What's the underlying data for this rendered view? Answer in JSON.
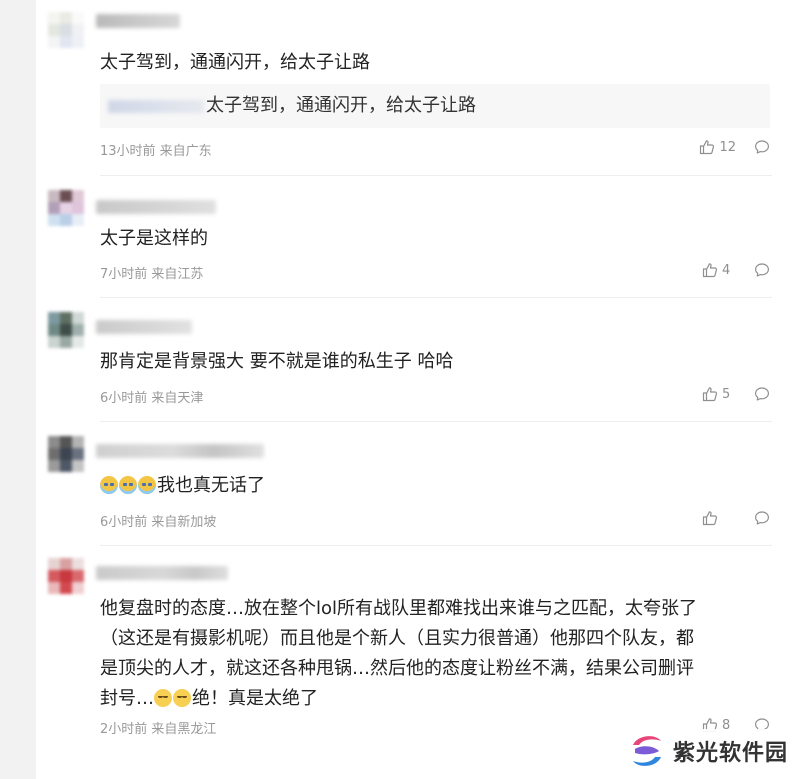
{
  "comments": [
    {
      "text": "太子驾到，通通闪开，给太子让路",
      "quote_text": "太子驾到，通通闪开，给太子让路",
      "meta": "13小时前 来自广东",
      "likes": "12"
    },
    {
      "text": "太子是这样的",
      "meta": "7小时前 来自江苏",
      "likes": "4"
    },
    {
      "text": "那肯定是背景强大 要不就是谁的私生子 哈哈",
      "meta": "6小时前 来自天津",
      "likes": "5"
    },
    {
      "text": "我也真无话了",
      "meta": "6小时前 来自新加坡",
      "likes": ""
    },
    {
      "lines": [
        "他复盘时的态度…放在整个lol所有战队里都难找出来谁与之匹配，太夸张了",
        "（这还是有摄影机呢）而且他是个新人（且实力很普通）他那四个队友，都",
        "是顶尖的人才，就这还各种甩锅…然后他的态度让粉丝不满，结果公司删评",
        "绝！真是太绝了"
      ],
      "line4_prefix": "封号…",
      "meta": "2小时前 来自黑龙江",
      "likes": "8"
    }
  ],
  "icons": {
    "like": "thumbs-up-icon",
    "reply": "speech-bubble-icon"
  },
  "watermark": {
    "text": "紫光软件园",
    "colors": [
      "#e8457a",
      "#2e86de",
      "#7b5cd6"
    ]
  }
}
